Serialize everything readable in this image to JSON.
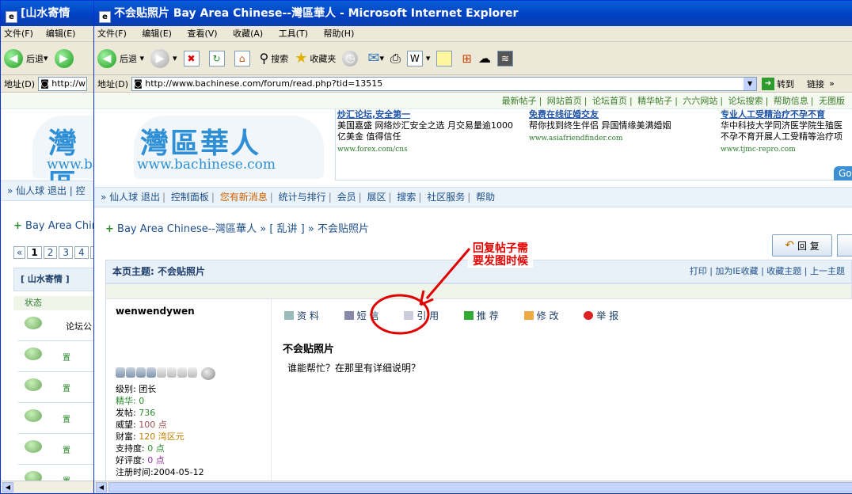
{
  "win1": {
    "title": "[山水寄情",
    "menu": [
      "文件(F)",
      "编辑(E)"
    ],
    "back_label": "后退",
    "address_label": "地址(D)",
    "address": "http://w",
    "nav_text": "» 仙人球 退出 | 控",
    "logo_cn": "灣區",
    "logo_url": "www.ba",
    "breadcrumb": "Bay Area Chir",
    "pager": [
      "«",
      "1",
      "2",
      "3",
      "4",
      "5"
    ],
    "board_tab": "[ 山水寄情 ]",
    "status_header": "状态",
    "rows": [
      "论坛公",
      "置",
      "置",
      "置",
      "置",
      "置"
    ]
  },
  "win2": {
    "title": "不会贴照片 Bay Area Chinese--灣區華人 - Microsoft Internet Explorer",
    "menu": [
      "文件(F)",
      "编辑(E)",
      "查看(V)",
      "收藏(A)",
      "工具(T)",
      "帮助(H)"
    ],
    "toolbar": {
      "back": "后退",
      "search": "搜索",
      "favorites": "收藏夹"
    },
    "address_label": "地址(D)",
    "address": "http://www.bachinese.com/forum/read.php?tid=13515",
    "go_label": "转到",
    "links_label": "链接"
  },
  "site": {
    "topnav": [
      "最新帖子",
      "网站首页",
      "论坛首页",
      "精华帖子",
      "六六网站",
      "论坛搜索",
      "帮助信息",
      "无图版"
    ],
    "logo_cn": "灣區華人",
    "logo_url": "www.bachinese.com",
    "ads": [
      {
        "title": "炒汇论坛,安全第一",
        "line1": "美国嘉盛 网络炒汇安全之选 月交易量逾1000",
        "line2": "亿美金 值得信任",
        "url": "www.forex.com/cns"
      },
      {
        "title": "免费在线征婚交友",
        "line1": "帮你找到终生伴侣 异国情缘美满婚姻",
        "line2": "",
        "url": "www.asiafriendfinder.com"
      },
      {
        "title": "专业人工受精治疗不孕不育",
        "line1": "华中科技大学同济医学院生殖医",
        "line2": "不孕不育开展人工受精等治疗项",
        "url": "www.tjmc-repro.com"
      }
    ],
    "google_tab": "Goo",
    "secnav": {
      "prefix": "» 仙人球",
      "items": [
        "退出",
        "控制面板",
        "您有新消息",
        "统计与排行",
        "会员",
        "展区",
        "搜索",
        "社区服务",
        "帮助"
      ]
    },
    "breadcrumb": {
      "site": "Bay Area Chinese--灣區華人",
      "board": "[ 乱讲 ]",
      "topic": "不会贴照片"
    },
    "reply_label": "回 复",
    "topic_header": "本页主题: 不会贴照片",
    "topic_tools": "打印 | 加为IE收藏 | 收藏主题 | 上一主题"
  },
  "post": {
    "username": "wenwendywen",
    "info": {
      "level": "级别: 团长",
      "essence": "精华: 0",
      "posts_label": "发帖: ",
      "posts": "736",
      "prestige_label": "威望: ",
      "prestige": "100 点",
      "wealth_label": "财富: ",
      "wealth": "120 湾区元",
      "support_label": "支持度: ",
      "support": "0 点",
      "rating_label": "好评度: ",
      "rating": "0 点",
      "reg": "注册时间:2004-05-12"
    },
    "actions": [
      "资 料",
      "短 信",
      "引 用",
      "推 荐",
      "修 改",
      "举 报"
    ],
    "title": "不会贴照片",
    "body": "谁能帮忙？在那里有详细说明？"
  },
  "annotation": [
    "回复帖子需",
    "要发图时候"
  ],
  "colors": {
    "xp_title": "#0a5fd8",
    "link": "#1e4f8a",
    "annotation": "#e00000"
  }
}
